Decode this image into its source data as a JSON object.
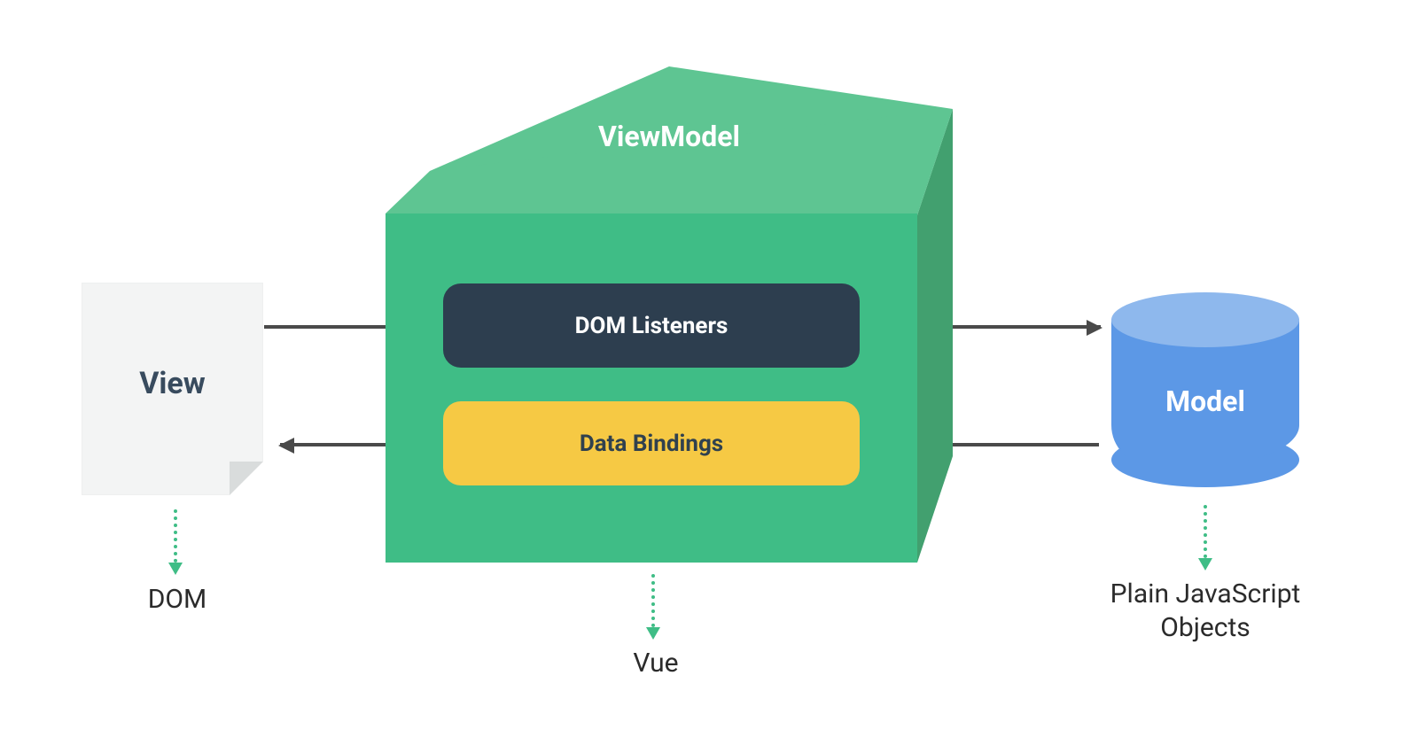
{
  "view": {
    "title": "View",
    "caption": "DOM"
  },
  "viewmodel": {
    "title": "ViewModel",
    "dom_listeners_label": "DOM Listeners",
    "data_bindings_label": "Data Bindings",
    "caption": "Vue"
  },
  "model": {
    "title": "Model",
    "caption": "Plain JavaScript Objects"
  },
  "colors": {
    "cube_top": "#5ec592",
    "cube_side": "#42a06f",
    "cube_front": "#3fbd86",
    "pill_listeners_bg": "#2d3e4f",
    "pill_bindings_bg": "#f6c944",
    "model_cylinder": "#5c98e6",
    "model_cylinder_top": "#8eb8ed",
    "view_card_bg": "#f3f4f4",
    "arrow": "#4a4a4a",
    "dotted_arrow": "#3fbd86"
  }
}
